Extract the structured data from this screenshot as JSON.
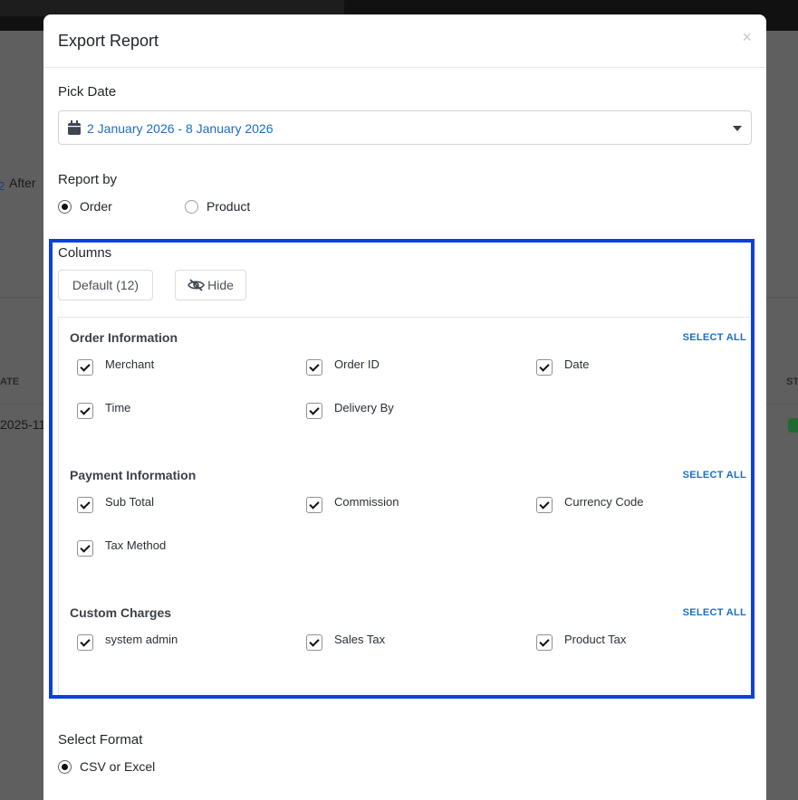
{
  "background": {
    "after_text": "After",
    "col_header_left": "ATE",
    "row_date": "2025-11-",
    "col_header_right": "ST"
  },
  "modal": {
    "title": "Export Report",
    "close_icon": "×",
    "pick_date": {
      "label": "Pick Date",
      "value": "2 January 2026 - 8 January 2026"
    },
    "report_by": {
      "label": "Report by",
      "options": [
        {
          "label": "Order",
          "selected": true
        },
        {
          "label": "Product",
          "selected": false
        }
      ]
    },
    "columns": {
      "title": "Columns",
      "default_button": "Default (12)",
      "hide_button": "Hide",
      "groups": [
        {
          "title": "Order Information",
          "select_all": "SELECT ALL",
          "items": [
            "Merchant",
            "Order ID",
            "Date",
            "Time",
            "Delivery By"
          ]
        },
        {
          "title": "Payment Information",
          "select_all": "SELECT ALL",
          "items": [
            "Sub Total",
            "Commission",
            "Currency Code",
            "Tax Method"
          ]
        },
        {
          "title": "Custom Charges",
          "select_all": "SELECT ALL",
          "items": [
            "system admin",
            "Sales Tax",
            "Product Tax"
          ]
        }
      ]
    },
    "select_format": {
      "label": "Select Format",
      "options": [
        {
          "label": "CSV or Excel",
          "selected": true
        }
      ]
    }
  },
  "colors": {
    "accent": "#1b6ec2",
    "highlight_border": "#0b3fe0",
    "overlay": "#6b6b6b"
  }
}
